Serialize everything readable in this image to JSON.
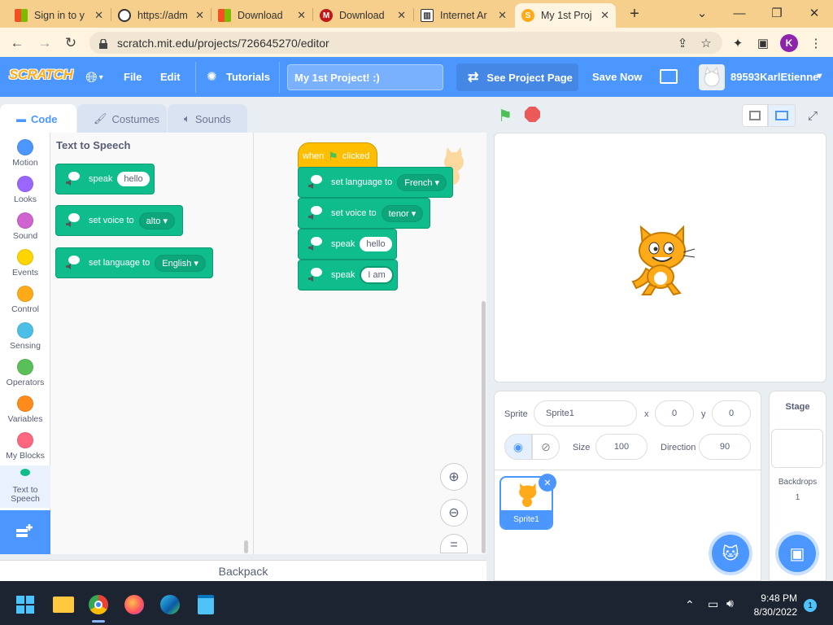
{
  "browser": {
    "tabs": [
      {
        "label": "Sign in to y",
        "icon": "microsoft-logo-icon"
      },
      {
        "label": "https://adm",
        "icon": "globe-icon"
      },
      {
        "label": "Download",
        "icon": "microsoft-logo-icon"
      },
      {
        "label": "Download",
        "icon": "mcafee-icon"
      },
      {
        "label": "Internet Ar",
        "icon": "archive-icon"
      },
      {
        "label": "My 1st Proj",
        "icon": "scratch-icon"
      }
    ],
    "url": "scratch.mit.edu/projects/726645270/editor",
    "profile_initial": "K"
  },
  "menu": {
    "logo": "SCRATCH",
    "file": "File",
    "edit": "Edit",
    "tutorials": "Tutorials",
    "project_title": "My 1st Project! :)",
    "see_project": "See Project Page",
    "save_now": "Save Now",
    "username": "89593KarlEtienne"
  },
  "editor_tabs": {
    "code": "Code",
    "costumes": "Costumes",
    "sounds": "Sounds"
  },
  "categories": [
    {
      "label": "Motion",
      "color": "#4c97ff"
    },
    {
      "label": "Looks",
      "color": "#9966ff"
    },
    {
      "label": "Sound",
      "color": "#cf63cf"
    },
    {
      "label": "Events",
      "color": "#ffd500"
    },
    {
      "label": "Control",
      "color": "#ffab19"
    },
    {
      "label": "Sensing",
      "color": "#4cbfe6"
    },
    {
      "label": "Operators",
      "color": "#59c059"
    },
    {
      "label": "Variables",
      "color": "#ff8c1a"
    },
    {
      "label": "My Blocks",
      "color": "#ff6680"
    },
    {
      "label": "Text to Speech",
      "color": "#0fbd8c"
    }
  ],
  "flyout": {
    "title": "Text to Speech",
    "blocks": [
      {
        "text": "speak",
        "arg": "hello"
      },
      {
        "text": "set voice to",
        "arg": "alto"
      },
      {
        "text": "set language to",
        "arg": "English"
      }
    ]
  },
  "script": {
    "hat_when": "when",
    "hat_clicked": "clicked",
    "blocks": [
      {
        "text": "set language to",
        "arg": "French"
      },
      {
        "text": "set voice to",
        "arg": "tenor"
      },
      {
        "text": "speak",
        "arg": "hello"
      },
      {
        "text": "speak",
        "arg": "I am"
      }
    ]
  },
  "backpack": "Backpack",
  "sprite_info": {
    "sprite_label": "Sprite",
    "sprite_name": "Sprite1",
    "x_label": "x",
    "x_value": "0",
    "y_label": "y",
    "y_value": "0",
    "show_label": "Show",
    "size_label": "Size",
    "size_value": "100",
    "direction_label": "Direction",
    "direction_value": "90",
    "thumbnail_name": "Sprite1"
  },
  "stage_panel": {
    "title": "Stage",
    "backdrops_label": "Backdrops",
    "backdrops_count": "1"
  },
  "taskbar": {
    "time": "9:48 PM",
    "date": "8/30/2022",
    "notifications": "1"
  },
  "colors": {
    "scratch_blue": "#4c97ff",
    "extension_green": "#0fbd8c",
    "events_yellow": "#ffbf00",
    "browser_tab_orange": "#f6cf8d"
  }
}
